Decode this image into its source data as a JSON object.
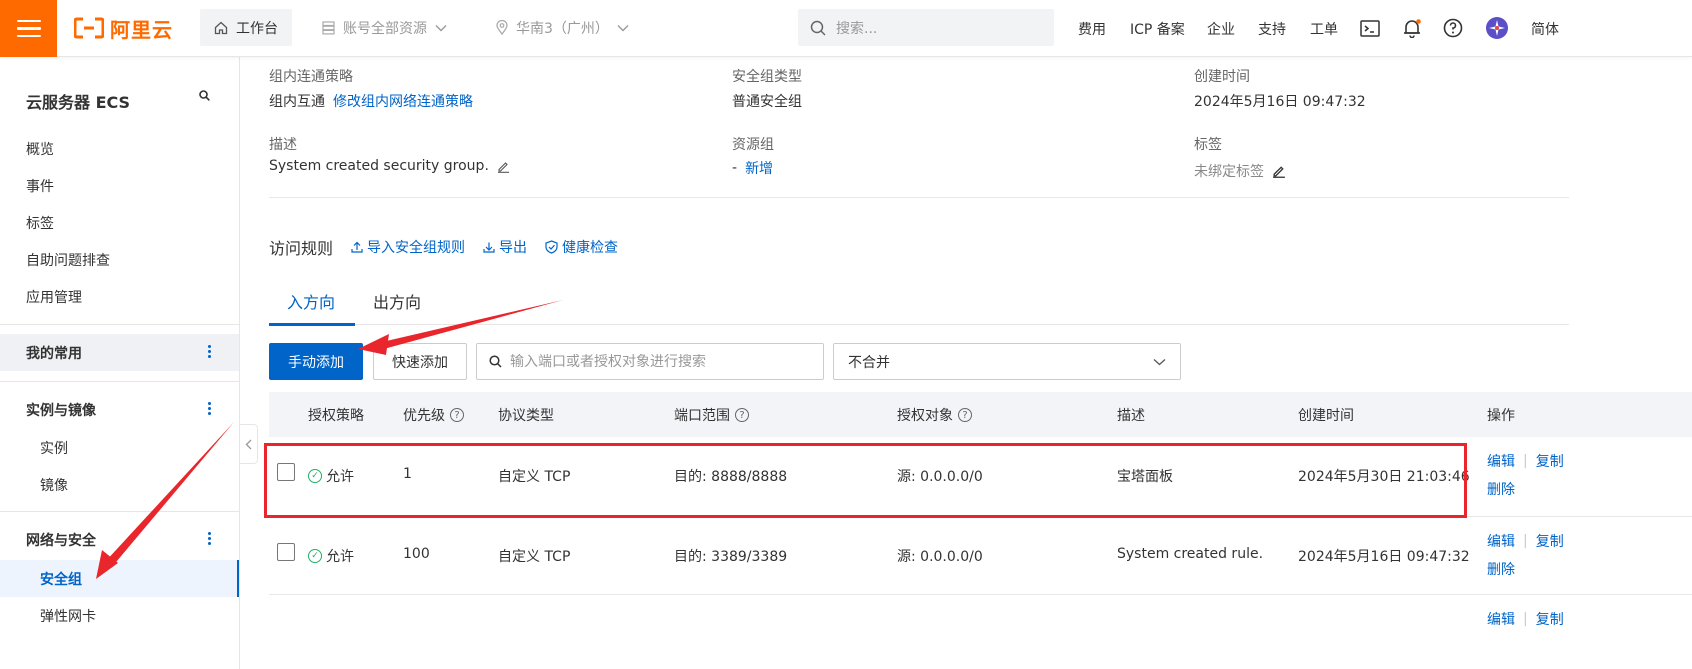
{
  "topbar": {
    "brand": "阿里云",
    "workbench": "工作台",
    "resource_scope": "账号全部资源",
    "region": "华南3（广州）",
    "search_placeholder": "搜索...",
    "nav": [
      "费用",
      "ICP 备案",
      "企业",
      "支持",
      "工单"
    ],
    "lang": "简体"
  },
  "sidebar": {
    "title": "云服务器 ECS",
    "items": [
      "概览",
      "事件",
      "标签",
      "自助问题排查",
      "应用管理"
    ],
    "group_favorites": "我的常用",
    "group_instances": "实例与镜像",
    "instances_sub": [
      "实例",
      "镜像"
    ],
    "group_network": "网络与安全",
    "network_sub_active": "安全组",
    "network_sub_next": "弹性网卡"
  },
  "info": {
    "conn_label": "组内连通策略",
    "conn_value": "组内互通",
    "conn_link": "修改组内网络连通策略",
    "type_label": "安全组类型",
    "type_value": "普通安全组",
    "created_label": "创建时间",
    "created_value": "2024年5月16日 09:47:32",
    "desc_label": "描述",
    "desc_value": "System created security group.",
    "rg_label": "资源组",
    "rg_value": "-",
    "rg_link": "新增",
    "tag_label": "标签",
    "tag_value": "未绑定标签"
  },
  "rules": {
    "title": "访问规则",
    "actions": [
      "导入安全组规则",
      "导出",
      "健康检查"
    ],
    "tabs": [
      "入方向",
      "出方向"
    ],
    "btn_manual": "手动添加",
    "btn_quick": "快速添加",
    "search_placeholder": "输入端口或者授权对象进行搜索",
    "merge_value": "不合并",
    "columns": [
      "授权策略",
      "优先级",
      "协议类型",
      "端口范围",
      "授权对象",
      "描述",
      "创建时间",
      "操作"
    ],
    "rows": [
      {
        "policy": "允许",
        "priority": "1",
        "protocol": "自定义 TCP",
        "port": "目的: 8888/8888",
        "source": "源: 0.0.0.0/0",
        "desc": "宝塔面板",
        "created": "2024年5月30日 21:03:46"
      },
      {
        "policy": "允许",
        "priority": "100",
        "protocol": "自定义 TCP",
        "port": "目的: 3389/3389",
        "source": "源: 0.0.0.0/0",
        "desc": "System created rule.",
        "created": "2024年5月16日 09:47:32"
      }
    ],
    "op_edit": "编辑",
    "op_copy": "复制",
    "op_delete": "删除"
  },
  "colors": {
    "brand": "#ff6a00",
    "primary": "#0064c8",
    "annotation": "#e8262b",
    "allow": "#23b066"
  }
}
